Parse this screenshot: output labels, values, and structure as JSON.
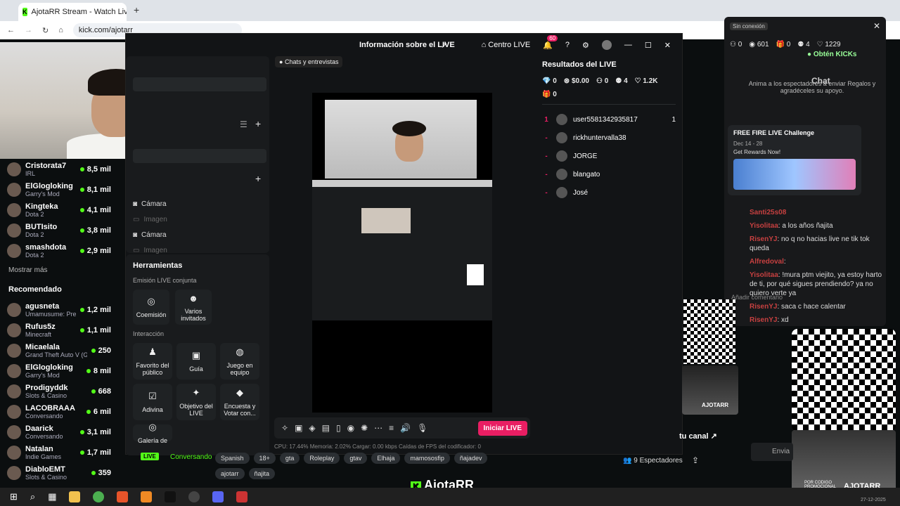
{
  "browser": {
    "tab_title": "AjotaRR Stream - Watch Live on",
    "url": "kick.com/ajotarr"
  },
  "sidebar": {
    "channels": [
      {
        "name": "Cristorata7",
        "category": "IRL",
        "viewers": "8,5 mil"
      },
      {
        "name": "ElGlogloking",
        "category": "Garry's Mod",
        "viewers": "8,1 mil"
      },
      {
        "name": "Kingteka",
        "category": "Dota 2",
        "viewers": "4,1 mil"
      },
      {
        "name": "BUTIsito",
        "category": "Dota 2",
        "viewers": "3,8 mil"
      },
      {
        "name": "smashdota",
        "category": "Dota 2",
        "viewers": "2,9 mil"
      }
    ],
    "show_more": "Mostrar más",
    "recommended_title": "Recomendado",
    "recommended": [
      {
        "name": "agusneta",
        "category": "Umamusume: Prett...",
        "viewers": "1,2 mil"
      },
      {
        "name": "Rufus5z",
        "category": "Minecraft",
        "viewers": "1,1 mil"
      },
      {
        "name": "Micaelala",
        "category": "Grand Theft Auto V (G...",
        "viewers": "250"
      },
      {
        "name": "ElGlogloking",
        "category": "Garry's Mod",
        "viewers": "8 mil"
      },
      {
        "name": "Prodigyddk",
        "category": "Slots & Casino",
        "viewers": "668"
      },
      {
        "name": "LACOBRAAA",
        "category": "Conversando",
        "viewers": "6 mil"
      },
      {
        "name": "Daarick",
        "category": "Conversando",
        "viewers": "3,1 mil"
      },
      {
        "name": "Natalan",
        "category": "Indie Games",
        "viewers": "1,7 mil"
      },
      {
        "name": "DiabloEMT",
        "category": "Slots & Casino",
        "viewers": "359"
      }
    ]
  },
  "studio": {
    "header": {
      "info": "Información sobre el LIVE",
      "center": "Centro LIVE",
      "notif_count": "60"
    },
    "sources": [
      {
        "label": "Cámara",
        "dim": false
      },
      {
        "label": "Imagen",
        "dim": true
      },
      {
        "label": "Cámara",
        "dim": false
      },
      {
        "label": "Imagen",
        "dim": true
      },
      {
        "label": "Imagen",
        "dim": true
      }
    ],
    "tools_title": "Herramientas",
    "joint_title": "Emisión LIVE conjunta",
    "joint_tools": [
      "Coemisión",
      "Varios invitados"
    ],
    "interaction_title": "Interacción",
    "interaction_tools": [
      "Favorito del público",
      "Guía",
      "Juego en equipo",
      "Adivina",
      "Objetivo del LIVE",
      "Encuesta y Votar con...",
      "Galería de"
    ],
    "chat_chip": "Chats y entrevistas",
    "golive": "Iniciar LIVE",
    "stats": "CPU: 17.44%   Memoria: 2.02%   Cargar: 0.00 kbps   Caídas de FPS   del codificador: 0",
    "results": {
      "title": "Resultados del LIVE",
      "row1": [
        "0",
        "$0.00",
        "0",
        "4",
        "1.2K"
      ],
      "row2": "0",
      "viewers": [
        {
          "rank": "1",
          "name": "user5581342935817",
          "score": "1"
        },
        {
          "rank": "-",
          "name": "rickhuntervalla38",
          "score": ""
        },
        {
          "rank": "-",
          "name": "JORGE",
          "score": ""
        },
        {
          "rank": "-",
          "name": "blangato",
          "score": ""
        },
        {
          "rank": "-",
          "name": "José",
          "score": ""
        }
      ]
    }
  },
  "chat": {
    "status": "Sin conexión",
    "stats": [
      "0",
      "601",
      "0",
      "4",
      "1229"
    ],
    "kicks_button": "Obtén KICKs",
    "title": "Chat",
    "intro": "Anima a los espectadores a enviar Regalos y agradéceles su apoyo.",
    "ff_title": "FREE FIRE LIVE Challenge",
    "ff_dates": "Dec 14 - 28",
    "ff_cta": "Get Rewards Now!",
    "messages": [
      {
        "user": "Santi25s08",
        "text": ""
      },
      {
        "user": "Yisolitaa",
        "text": ": a los años ñajita"
      },
      {
        "user": "RisenYJ",
        "text": ": no q no hacias live ne tik tok queda"
      },
      {
        "user": "Alfredoval",
        "text": ":"
      },
      {
        "user": "Yisolitaa",
        "text": ": !mura ptm viejito, ya estoy harto de ti, por qué sigues prendiendo? ya no quiero verte ya"
      },
      {
        "user": "RisenYJ",
        "text": ": saca c hace calentar"
      },
      {
        "user": "RisenYJ",
        "text": ": xd"
      }
    ],
    "input_placeholder": "Añadir comentario",
    "send": "Envia"
  },
  "stream_info": {
    "category": "Conversando",
    "tags": [
      "Spanish",
      "18+",
      "gta",
      "Roleplay",
      "gtav",
      "Elhaja",
      "mamososfip",
      "ñajadev",
      "ajotarr",
      "ñajita"
    ],
    "viewers": "9 Espectadores",
    "channel_label": "tu canal",
    "logo": "AjotaRR",
    "promo": "POR CODIGO PROMOCIONAL",
    "promo_code": "AJOTARR",
    "date": "27-12-2025"
  }
}
